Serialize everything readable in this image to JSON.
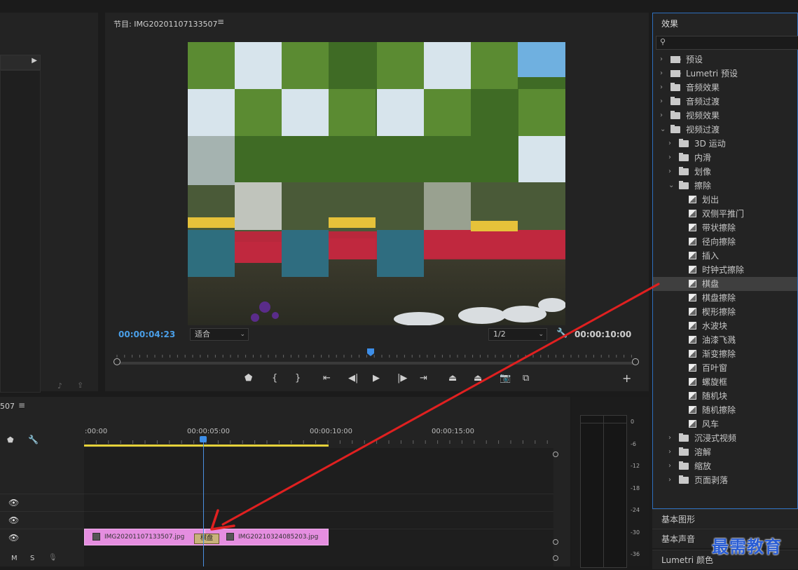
{
  "monitor": {
    "title": "节目: IMG20201107133507",
    "menu_icon": "≡",
    "timecode_current": "00:00:04:23",
    "timecode_duration": "00:00:10:00",
    "fit_value": "适合",
    "resolution_value": "1/2"
  },
  "effects_panel": {
    "title": "效果",
    "search_icon": "magnifier-icon",
    "items": [
      {
        "label": "预设",
        "level": 0,
        "kind": "preset-folder",
        "expanded": false
      },
      {
        "label": "Lumetri 预设",
        "level": 0,
        "kind": "preset-folder",
        "expanded": false
      },
      {
        "label": "音频效果",
        "level": 0,
        "kind": "folder",
        "expanded": false
      },
      {
        "label": "音频过渡",
        "level": 0,
        "kind": "folder",
        "expanded": false
      },
      {
        "label": "视频效果",
        "level": 0,
        "kind": "folder",
        "expanded": false
      },
      {
        "label": "视频过渡",
        "level": 0,
        "kind": "folder",
        "expanded": true
      },
      {
        "label": "3D 运动",
        "level": 1,
        "kind": "folder",
        "expanded": false
      },
      {
        "label": "内滑",
        "level": 1,
        "kind": "folder",
        "expanded": false
      },
      {
        "label": "划像",
        "level": 1,
        "kind": "folder",
        "expanded": false
      },
      {
        "label": "擦除",
        "level": 1,
        "kind": "folder",
        "expanded": true
      },
      {
        "label": "划出",
        "level": 2,
        "kind": "transition"
      },
      {
        "label": "双侧平推门",
        "level": 2,
        "kind": "transition"
      },
      {
        "label": "带状擦除",
        "level": 2,
        "kind": "transition"
      },
      {
        "label": "径向擦除",
        "level": 2,
        "kind": "transition"
      },
      {
        "label": "插入",
        "level": 2,
        "kind": "transition"
      },
      {
        "label": "时钟式擦除",
        "level": 2,
        "kind": "transition"
      },
      {
        "label": "棋盘",
        "level": 2,
        "kind": "transition",
        "selected": true
      },
      {
        "label": "棋盘擦除",
        "level": 2,
        "kind": "transition"
      },
      {
        "label": "楔形擦除",
        "level": 2,
        "kind": "transition"
      },
      {
        "label": "水波块",
        "level": 2,
        "kind": "transition"
      },
      {
        "label": "油漆飞溅",
        "level": 2,
        "kind": "transition"
      },
      {
        "label": "渐变擦除",
        "level": 2,
        "kind": "transition"
      },
      {
        "label": "百叶窗",
        "level": 2,
        "kind": "transition"
      },
      {
        "label": "螺旋框",
        "level": 2,
        "kind": "transition"
      },
      {
        "label": "随机块",
        "level": 2,
        "kind": "transition"
      },
      {
        "label": "随机擦除",
        "level": 2,
        "kind": "transition"
      },
      {
        "label": "风车",
        "level": 2,
        "kind": "transition"
      },
      {
        "label": "沉浸式视频",
        "level": 1,
        "kind": "folder",
        "expanded": false
      },
      {
        "label": "溶解",
        "level": 1,
        "kind": "folder",
        "expanded": false
      },
      {
        "label": "缩放",
        "level": 1,
        "kind": "folder",
        "expanded": false
      },
      {
        "label": "页面剥落",
        "level": 1,
        "kind": "folder",
        "expanded": false
      }
    ]
  },
  "side_tabs": [
    "基本图形",
    "基本声音",
    "Lumetri 颜色"
  ],
  "timeline": {
    "title": "507",
    "menu_icon": "≡",
    "ruler_labels": [
      ":00:00",
      "00:00:05:00",
      "00:00:10:00",
      "00:00:15:00"
    ],
    "clips": [
      {
        "name": "IMG20201107133507.jpg"
      },
      {
        "name": "IMG20210324085203.jpg"
      }
    ],
    "transition_label": "棋盘",
    "track_buttons": {
      "m": "M",
      "s": "S"
    }
  },
  "meter": {
    "db_labels": [
      "0",
      "-6",
      "-12",
      "-18",
      "-24",
      "-30",
      "-36"
    ]
  },
  "watermark": "最需教育",
  "colors": {
    "accent_blue": "#4a9fe8",
    "clip_pink": "#e58ee0",
    "work_area_yellow": "#e6d23a",
    "arrow_red": "#e02020",
    "watermark_blue": "#2a5dd4"
  }
}
